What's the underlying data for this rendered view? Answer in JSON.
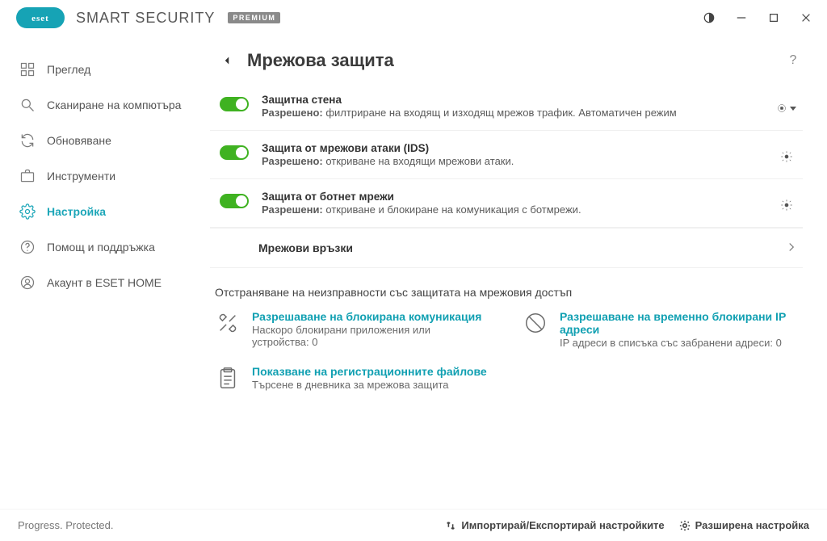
{
  "brand": {
    "name": "SMART SECURITY",
    "badge": "PREMIUM"
  },
  "sidebar": {
    "items": [
      {
        "label": "Преглед"
      },
      {
        "label": "Сканиране на компютъра"
      },
      {
        "label": "Обновяване"
      },
      {
        "label": "Инструменти"
      },
      {
        "label": "Настройка"
      },
      {
        "label": "Помощ и поддръжка"
      },
      {
        "label": "Акаунт в ESET HOME"
      }
    ]
  },
  "page": {
    "title": "Мрежова защита"
  },
  "settings": [
    {
      "title": "Защитна стена",
      "allowed_label": "Разрешено:",
      "desc": "филтриране на входящ и изходящ мрежов трафик. Автоматичен режим"
    },
    {
      "title": "Защита от мрежови атаки (IDS)",
      "allowed_label": "Разрешено:",
      "desc": "откриване на входящи мрежови атаки."
    },
    {
      "title": "Защита от ботнет мрежи",
      "allowed_label": "Разрешени:",
      "desc": "откриване и блокиране на комуникация с ботмрежи."
    }
  ],
  "link_row": {
    "label": "Мрежови връзки"
  },
  "troubleshoot": {
    "heading": "Отстраняване на неизправности със защитата на мрежовия достъп",
    "items": [
      {
        "title": "Разрешаване на блокирана комуникация",
        "desc": "Наскоро блокирани приложения или устройства: 0"
      },
      {
        "title": "Разрешаване на временно блокирани IP адреси",
        "desc": "IP адреси в списъка със забранени адреси: 0"
      },
      {
        "title": "Показване на регистрационните файлове",
        "desc": "Търсене в дневника за мрежова защита"
      }
    ]
  },
  "footer": {
    "tagline": "Progress. Protected.",
    "import_export": "Импортирай/Експортирай настройките",
    "advanced": "Разширена настройка"
  }
}
